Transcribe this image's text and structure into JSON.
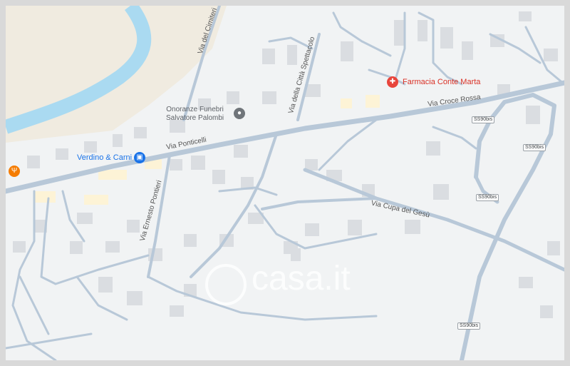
{
  "map": {
    "colors": {
      "background": "#f1f3f4",
      "sand": "#f0ebe0",
      "river": "#aadaf1",
      "road": "#b8c8d8",
      "building": "#dadde1",
      "highlight": "#fdf3d6"
    },
    "roads": {
      "via_ponticelli": "Via Ponticelli",
      "via_croce_rossa": "Via Croce Rossa",
      "via_della_citta": "Via della Città Spettacolo",
      "via_del_cimiteri": "Via del Cimiteri",
      "via_ernesto": "Via Ernesto Pontieri",
      "via_cupa": "Via Cupa del Gesù"
    },
    "shields": {
      "s1": "SS90bis",
      "s2": "SS90bis",
      "s3": "SS90bis",
      "s4": "SS90bis"
    },
    "pois": {
      "farmacia": "Farmacia Conte Marta",
      "onoranze_line1": "Onoranze Funebri",
      "onoranze_line2": "Salvatore Palombi",
      "verdino": "Verdino & Carni"
    },
    "icons": {
      "farmacia": "pharmacy-icon",
      "onoranze": "place-icon",
      "verdino": "shopping-bag-icon",
      "restaurant": "restaurant-icon"
    },
    "watermark": "casa.it"
  }
}
